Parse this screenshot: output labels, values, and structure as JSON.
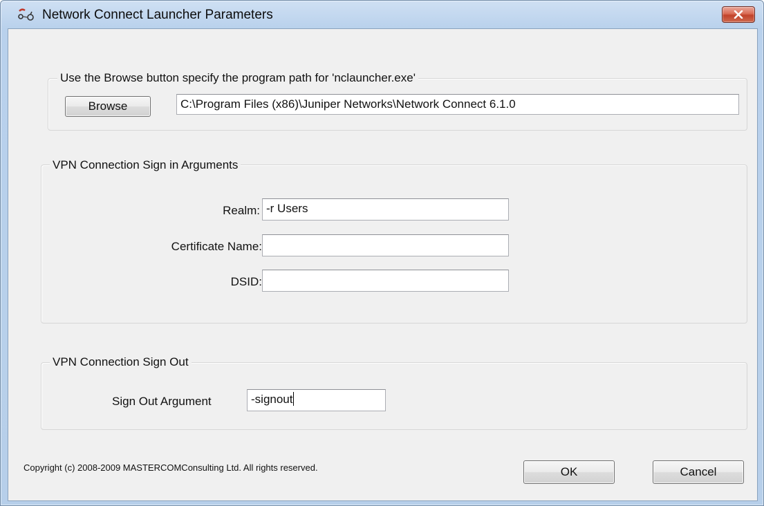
{
  "window": {
    "title": "Network Connect Launcher Parameters",
    "close_icon": "close-x-icon",
    "app_icon": "network-connect-icon"
  },
  "program_path": {
    "legend": "Use the Browse button specify the program path for 'nclauncher.exe'",
    "browse_label": "Browse",
    "path_value": "C:\\Program Files (x86)\\Juniper Networks\\Network Connect 6.1.0"
  },
  "sign_in": {
    "legend": "VPN Connection Sign in Arguments",
    "realm_label": "Realm:",
    "realm_value": "-r Users",
    "certificate_label": "Certificate Name:",
    "certificate_value": "",
    "dsid_label": "DSID:",
    "dsid_value": ""
  },
  "sign_out": {
    "legend": "VPN Connection Sign Out",
    "argument_label": "Sign Out Argument",
    "argument_value": "-signout"
  },
  "footer": {
    "copyright": "Copyright (c) 2008-2009 MASTERCOMConsulting Ltd. All rights reserved.",
    "ok_label": "OK",
    "cancel_label": "Cancel"
  },
  "colors": {
    "title_bar": "#b9d1ec",
    "client_background": "#f0f0f0",
    "close_button": "#c1432b"
  }
}
